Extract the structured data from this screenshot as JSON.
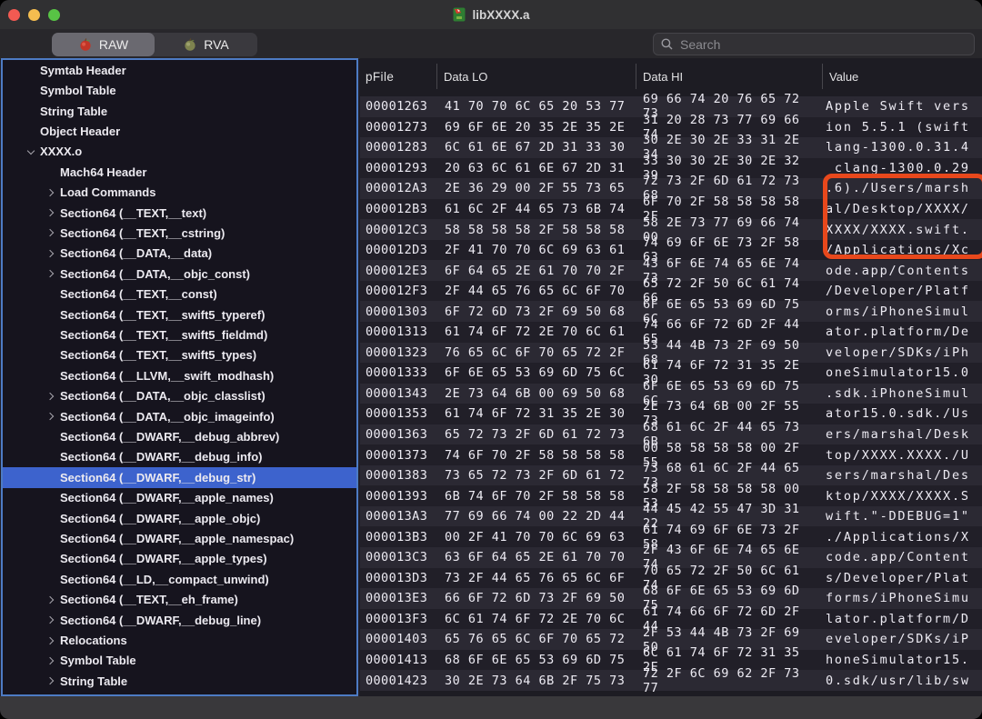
{
  "window": {
    "title": "libXXXX.a"
  },
  "toolbar": {
    "tabs": [
      {
        "label": "RAW",
        "selected": true,
        "icon": "red-apple-icon"
      },
      {
        "label": "RVA",
        "selected": false,
        "icon": "green-apple-icon"
      }
    ],
    "search_placeholder": "Search"
  },
  "sidebar": {
    "items": [
      {
        "label": "Symtab Header",
        "indent": 0,
        "chevron": null,
        "selected": false
      },
      {
        "label": "Symbol Table",
        "indent": 0,
        "chevron": null,
        "selected": false
      },
      {
        "label": "String Table",
        "indent": 0,
        "chevron": null,
        "selected": false
      },
      {
        "label": "Object Header",
        "indent": 0,
        "chevron": null,
        "selected": false
      },
      {
        "label": "XXXX.o",
        "indent": 0,
        "chevron": "down",
        "selected": false
      },
      {
        "label": "Mach64 Header",
        "indent": 1,
        "chevron": null,
        "selected": false
      },
      {
        "label": "Load Commands",
        "indent": 1,
        "chevron": "right",
        "selected": false
      },
      {
        "label": "Section64 (__TEXT,__text)",
        "indent": 1,
        "chevron": "right",
        "selected": false
      },
      {
        "label": "Section64 (__TEXT,__cstring)",
        "indent": 1,
        "chevron": "right",
        "selected": false
      },
      {
        "label": "Section64 (__DATA,__data)",
        "indent": 1,
        "chevron": "right",
        "selected": false
      },
      {
        "label": "Section64 (__DATA,__objc_const)",
        "indent": 1,
        "chevron": "right",
        "selected": false
      },
      {
        "label": "Section64 (__TEXT,__const)",
        "indent": 1,
        "chevron": null,
        "selected": false
      },
      {
        "label": "Section64 (__TEXT,__swift5_typeref)",
        "indent": 1,
        "chevron": null,
        "selected": false
      },
      {
        "label": "Section64 (__TEXT,__swift5_fieldmd)",
        "indent": 1,
        "chevron": null,
        "selected": false
      },
      {
        "label": "Section64 (__TEXT,__swift5_types)",
        "indent": 1,
        "chevron": null,
        "selected": false
      },
      {
        "label": "Section64 (__LLVM,__swift_modhash)",
        "indent": 1,
        "chevron": null,
        "selected": false
      },
      {
        "label": "Section64 (__DATA,__objc_classlist)",
        "indent": 1,
        "chevron": "right",
        "selected": false
      },
      {
        "label": "Section64 (__DATA,__objc_imageinfo)",
        "indent": 1,
        "chevron": "right",
        "selected": false
      },
      {
        "label": "Section64 (__DWARF,__debug_abbrev)",
        "indent": 1,
        "chevron": null,
        "selected": false
      },
      {
        "label": "Section64 (__DWARF,__debug_info)",
        "indent": 1,
        "chevron": null,
        "selected": false
      },
      {
        "label": "Section64 (__DWARF,__debug_str)",
        "indent": 1,
        "chevron": null,
        "selected": true
      },
      {
        "label": "Section64 (__DWARF,__apple_names)",
        "indent": 1,
        "chevron": null,
        "selected": false
      },
      {
        "label": "Section64 (__DWARF,__apple_objc)",
        "indent": 1,
        "chevron": null,
        "selected": false
      },
      {
        "label": "Section64 (__DWARF,__apple_namespac)",
        "indent": 1,
        "chevron": null,
        "selected": false
      },
      {
        "label": "Section64 (__DWARF,__apple_types)",
        "indent": 1,
        "chevron": null,
        "selected": false
      },
      {
        "label": "Section64 (__LD,__compact_unwind)",
        "indent": 1,
        "chevron": null,
        "selected": false
      },
      {
        "label": "Section64 (__TEXT,__eh_frame)",
        "indent": 1,
        "chevron": "right",
        "selected": false
      },
      {
        "label": "Section64 (__DWARF,__debug_line)",
        "indent": 1,
        "chevron": "right",
        "selected": false
      },
      {
        "label": "Relocations",
        "indent": 1,
        "chevron": "right",
        "selected": false
      },
      {
        "label": "Symbol Table",
        "indent": 1,
        "chevron": "right",
        "selected": false
      },
      {
        "label": "String Table",
        "indent": 1,
        "chevron": "right",
        "selected": false
      }
    ]
  },
  "table": {
    "columns": [
      "pFile",
      "Data LO",
      "Data HI",
      "Value"
    ],
    "rows": [
      {
        "pfile": "00001263",
        "lo": "41 70 70 6C 65 20 53 77",
        "hi": "69 66 74 20 76 65 72 73",
        "value": "Apple Swift vers"
      },
      {
        "pfile": "00001273",
        "lo": "69 6F 6E 20 35 2E 35 2E",
        "hi": "31 20 28 73 77 69 66 74",
        "value": "ion 5.5.1 (swift"
      },
      {
        "pfile": "00001283",
        "lo": "6C 61 6E 67 2D 31 33 30",
        "hi": "30 2E 30 2E 33 31 2E 34",
        "value": "lang-1300.0.31.4"
      },
      {
        "pfile": "00001293",
        "lo": "20 63 6C 61 6E 67 2D 31",
        "hi": "33 30 30 2E 30 2E 32 39",
        "value": " clang-1300.0.29"
      },
      {
        "pfile": "000012A3",
        "lo": "2E 36 29 00 2F 55 73 65",
        "hi": "72 73 2F 6D 61 72 73 68",
        "value": ".6)./Users/marsh"
      },
      {
        "pfile": "000012B3",
        "lo": "61 6C 2F 44 65 73 6B 74",
        "hi": "6F 70 2F 58 58 58 58 2F",
        "value": "al/Desktop/XXXX/"
      },
      {
        "pfile": "000012C3",
        "lo": "58 58 58 58 2F 58 58 58",
        "hi": "58 2E 73 77 69 66 74 00",
        "value": "XXXX/XXXX.swift."
      },
      {
        "pfile": "000012D3",
        "lo": "2F 41 70 70 6C 69 63 61",
        "hi": "74 69 6F 6E 73 2F 58 63",
        "value": "/Applications/Xc"
      },
      {
        "pfile": "000012E3",
        "lo": "6F 64 65 2E 61 70 70 2F",
        "hi": "43 6F 6E 74 65 6E 74 73",
        "value": "ode.app/Contents"
      },
      {
        "pfile": "000012F3",
        "lo": "2F 44 65 76 65 6C 6F 70",
        "hi": "65 72 2F 50 6C 61 74 66",
        "value": "/Developer/Platf"
      },
      {
        "pfile": "00001303",
        "lo": "6F 72 6D 73 2F 69 50 68",
        "hi": "6F 6E 65 53 69 6D 75 6C",
        "value": "orms/iPhoneSimul"
      },
      {
        "pfile": "00001313",
        "lo": "61 74 6F 72 2E 70 6C 61",
        "hi": "74 66 6F 72 6D 2F 44 65",
        "value": "ator.platform/De"
      },
      {
        "pfile": "00001323",
        "lo": "76 65 6C 6F 70 65 72 2F",
        "hi": "53 44 4B 73 2F 69 50 68",
        "value": "veloper/SDKs/iPh"
      },
      {
        "pfile": "00001333",
        "lo": "6F 6E 65 53 69 6D 75 6C",
        "hi": "61 74 6F 72 31 35 2E 30",
        "value": "oneSimulator15.0"
      },
      {
        "pfile": "00001343",
        "lo": "2E 73 64 6B 00 69 50 68",
        "hi": "6F 6E 65 53 69 6D 75 6C",
        "value": ".sdk.iPhoneSimul"
      },
      {
        "pfile": "00001353",
        "lo": "61 74 6F 72 31 35 2E 30",
        "hi": "2E 73 64 6B 00 2F 55 73",
        "value": "ator15.0.sdk./Us"
      },
      {
        "pfile": "00001363",
        "lo": "65 72 73 2F 6D 61 72 73",
        "hi": "68 61 6C 2F 44 65 73 6B",
        "value": "ers/marshal/Desk"
      },
      {
        "pfile": "00001373",
        "lo": "74 6F 70 2F 58 58 58 58",
        "hi": "00 58 58 58 58 00 2F 55",
        "value": "top/XXXX.XXXX./U"
      },
      {
        "pfile": "00001383",
        "lo": "73 65 72 73 2F 6D 61 72",
        "hi": "73 68 61 6C 2F 44 65 73",
        "value": "sers/marshal/Des"
      },
      {
        "pfile": "00001393",
        "lo": "6B 74 6F 70 2F 58 58 58",
        "hi": "58 2F 58 58 58 58 00 53",
        "value": "ktop/XXXX/XXXX.S"
      },
      {
        "pfile": "000013A3",
        "lo": "77 69 66 74 00 22 2D 44",
        "hi": "44 45 42 55 47 3D 31 22",
        "value": "wift.\"-DDEBUG=1\""
      },
      {
        "pfile": "000013B3",
        "lo": "00 2F 41 70 70 6C 69 63",
        "hi": "61 74 69 6F 6E 73 2F 58",
        "value": "./Applications/X"
      },
      {
        "pfile": "000013C3",
        "lo": "63 6F 64 65 2E 61 70 70",
        "hi": "2F 43 6F 6E 74 65 6E 74",
        "value": "code.app/Content"
      },
      {
        "pfile": "000013D3",
        "lo": "73 2F 44 65 76 65 6C 6F",
        "hi": "70 65 72 2F 50 6C 61 74",
        "value": "s/Developer/Plat"
      },
      {
        "pfile": "000013E3",
        "lo": "66 6F 72 6D 73 2F 69 50",
        "hi": "68 6F 6E 65 53 69 6D 75",
        "value": "forms/iPhoneSimu"
      },
      {
        "pfile": "000013F3",
        "lo": "6C 61 74 6F 72 2E 70 6C",
        "hi": "61 74 66 6F 72 6D 2F 44",
        "value": "lator.platform/D"
      },
      {
        "pfile": "00001403",
        "lo": "65 76 65 6C 6F 70 65 72",
        "hi": "2F 53 44 4B 73 2F 69 50",
        "value": "eveloper/SDKs/iP"
      },
      {
        "pfile": "00001413",
        "lo": "68 6F 6E 65 53 69 6D 75",
        "hi": "6C 61 74 6F 72 31 35 2E",
        "value": "honeSimulator15."
      },
      {
        "pfile": "00001423",
        "lo": "30 2E 73 64 6B 2F 75 73",
        "hi": "72 2F 6C 69 62 2F 73 77",
        "value": "0.sdk/usr/lib/sw"
      }
    ]
  },
  "annotation": {
    "shape": "rectangle",
    "color": "#E8481C",
    "highlighted_rows": [
      "000012A3",
      "000012B3",
      "000012C3"
    ],
    "highlighted_text": [
      ".6)./Users/marsh",
      "al/Desktop/XXXX/",
      "XXXX/XXXX.swift."
    ]
  },
  "colors": {
    "selection_blue": "#3D63CD",
    "sidebar_focus_ring": "#4D7BC4",
    "row_stripe_light": "#2B2933",
    "row_stripe_dark": "#211F28"
  }
}
